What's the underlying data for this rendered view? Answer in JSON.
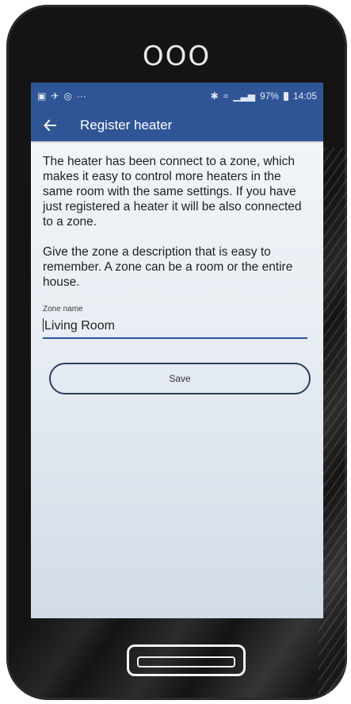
{
  "device": {
    "speaker_dots": "OOO"
  },
  "statusbar": {
    "left_icons": [
      "image-icon",
      "notification-icon",
      "app-icon",
      "more-icon"
    ],
    "more_text": "···",
    "right_text": "97%",
    "time": "14:05"
  },
  "appbar": {
    "title": "Register heater"
  },
  "content": {
    "paragraph1": "The heater has been connect to a zone, which makes it easy to control more heaters in the same room with the same settings. If you have just registered a heater it will be also connected to a zone.",
    "paragraph2": "Give the zone a description that is easy to remember. A zone can be a room or the entire house.",
    "zone_label": "Zone name",
    "zone_value": "Living Room",
    "save_label": "Save"
  },
  "colors": {
    "appbar": "#2f5596",
    "screen_bg": "#eef2f6"
  }
}
